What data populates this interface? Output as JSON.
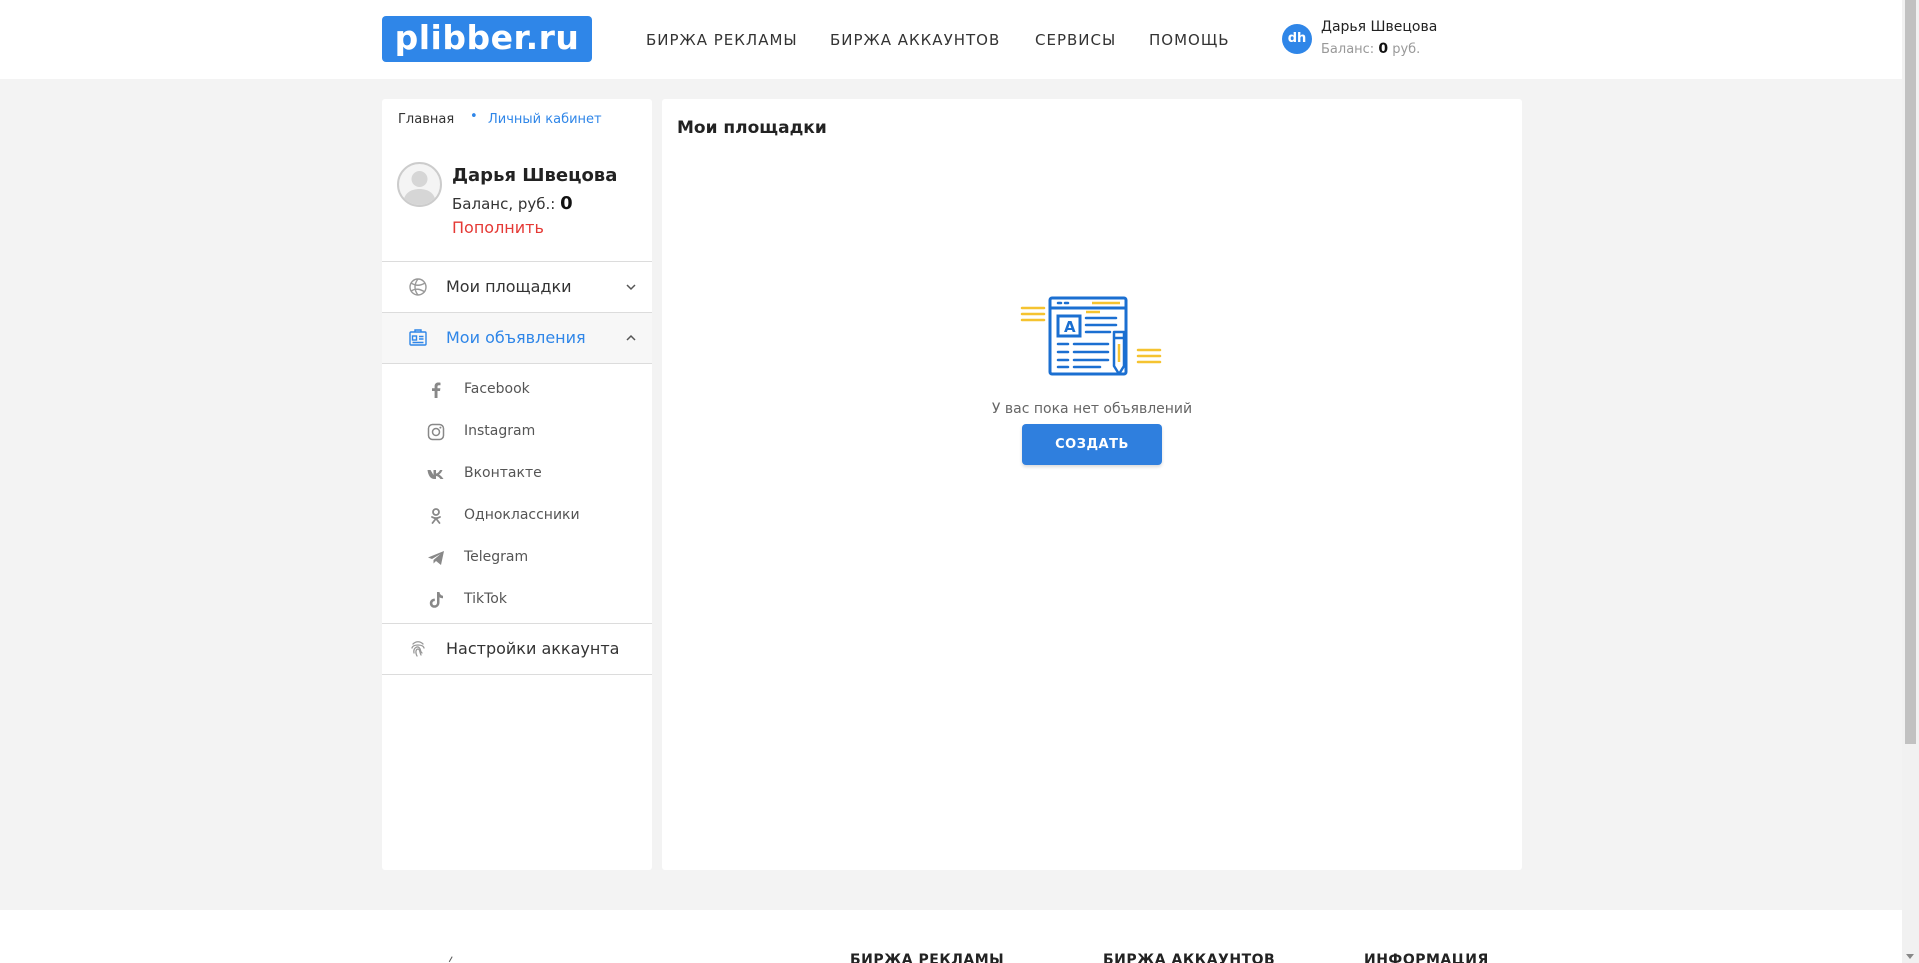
{
  "header": {
    "logo": "plibber.ru",
    "nav": [
      "БИРЖА РЕКЛАМЫ",
      "БИРЖА АККАУНТОВ",
      "СЕРВИСЫ",
      "ПОМОЩЬ"
    ],
    "user": {
      "initials": "dh",
      "name": "Дарья Швецова",
      "balance_label": "Баланс:",
      "balance_value": "0",
      "currency": "руб."
    }
  },
  "breadcrumb": {
    "home": "Главная",
    "separator": "•",
    "current": "Личный кабинет"
  },
  "profile": {
    "name": "Дарья Швецова",
    "balance_label": "Баланс, руб.:",
    "balance_value": "0",
    "topup_label": "Пополнить"
  },
  "sidebar": {
    "menu": [
      {
        "label": "Мои площадки",
        "icon": "basketball-icon",
        "expanded": false
      },
      {
        "label": "Мои объявления",
        "icon": "ad-card-icon",
        "expanded": true
      },
      {
        "label": "Настройки аккаунта",
        "icon": "fingerprint-icon",
        "expanded": false
      }
    ],
    "submenu": [
      {
        "label": "Facebook",
        "icon": "facebook-icon"
      },
      {
        "label": "Instagram",
        "icon": "instagram-icon"
      },
      {
        "label": "Вконтакте",
        "icon": "vk-icon"
      },
      {
        "label": "Одноклассники",
        "icon": "odnoklassniki-icon"
      },
      {
        "label": "Telegram",
        "icon": "telegram-icon"
      },
      {
        "label": "TikTok",
        "icon": "tiktok-icon"
      }
    ]
  },
  "main": {
    "title": "Мои площадки",
    "empty_text": "У вас пока нет объявлений",
    "create_button": "СОЗДАТЬ"
  },
  "footer": {
    "headings": [
      "БИРЖА РЕКЛАМЫ",
      "БИРЖА АККАУНТОВ",
      "ИНФОРМАЦИЯ"
    ]
  },
  "colors": {
    "accent": "#2f86e8",
    "danger": "#e53935",
    "illustration_yellow": "#f5c330",
    "illustration_blue": "#1b6fd1"
  }
}
